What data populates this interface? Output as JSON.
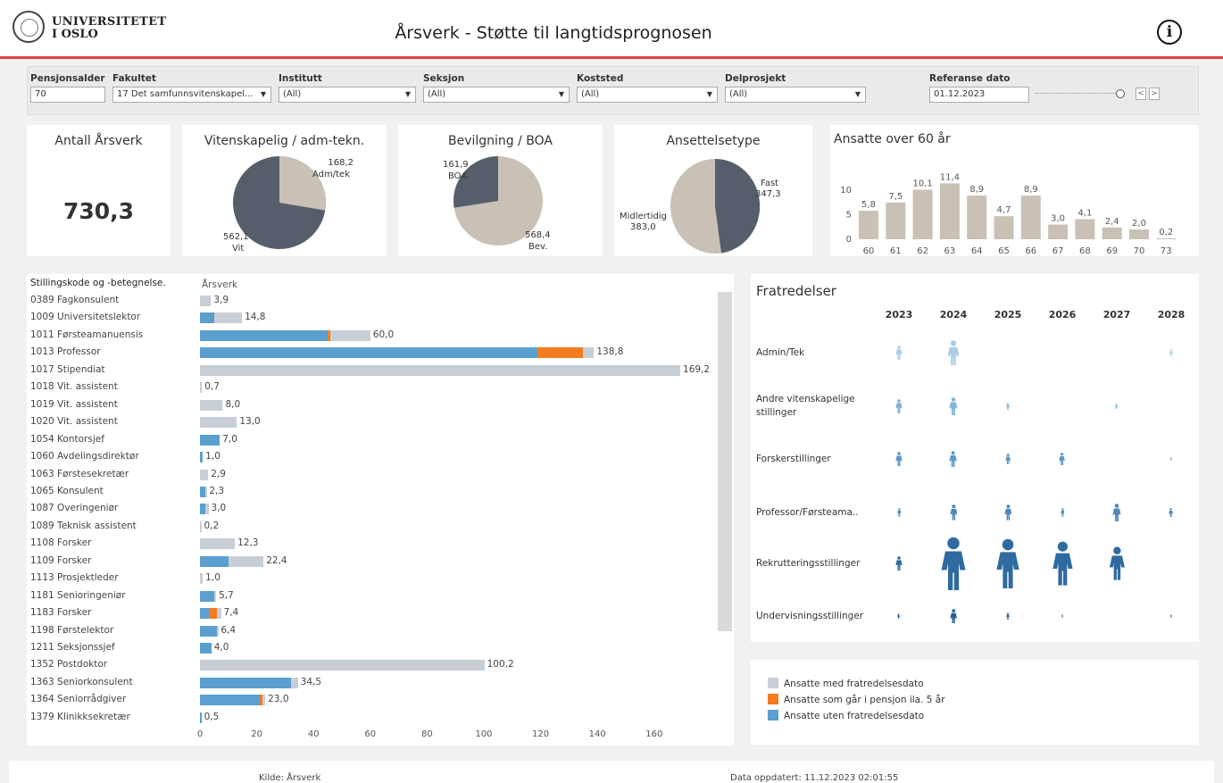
{
  "header": {
    "logo_line1": "UNIVERSITETET",
    "logo_line2": "I OSLO",
    "title": "Årsverk - Støtte til langtidsprognosen",
    "info_icon": "ⓘ"
  },
  "filters": {
    "pensjonsalder": {
      "label": "Pensjonsalder",
      "value": "70"
    },
    "fakultet": {
      "label": "Fakultet",
      "value": "17 Det samfunnsvitenskapel..."
    },
    "institutt": {
      "label": "Institutt",
      "value": "(All)"
    },
    "seksjon": {
      "label": "Seksjon",
      "value": "(All)"
    },
    "koststed": {
      "label": "Koststed",
      "value": "(All)"
    },
    "delprosjekt": {
      "label": "Delprosjekt",
      "value": "(All)"
    },
    "referanse": {
      "label": "Referanse dato",
      "value": "01.12.2023"
    }
  },
  "kpi": {
    "title": "Antall Årsverk",
    "value": "730,3"
  },
  "pies": {
    "vit": {
      "title": "Vitenskapelig / adm-tekn.",
      "a_val": "168,2",
      "a_lbl": "Adm/tek",
      "b_val": "562,1",
      "b_lbl": "Vit"
    },
    "bev": {
      "title": "Bevilgning / BOA",
      "a_val": "161,9",
      "a_lbl": "BOA",
      "b_val": "568,4",
      "b_lbl": "Bev."
    },
    "ans": {
      "title": "Ansettelsetype",
      "a_lbl": "Fast",
      "a_val": "347,3",
      "b_lbl": "Midlertidig",
      "b_val": "383,0"
    }
  },
  "over60": {
    "title": "Ansatte over 60 år"
  },
  "barlist": {
    "header_label": "Stillingskode og -betegnelse.",
    "header_value": "Årsverk"
  },
  "legend": {
    "grey": "Ansatte med fratredelsesdato",
    "orange": "Ansatte som går i pensjon ila. 5 år",
    "blue": "Ansatte uten fratredelsesdato"
  },
  "fratredelser": {
    "title": "Fratredelser",
    "years": [
      "2023",
      "2024",
      "2025",
      "2026",
      "2027",
      "2028"
    ],
    "categories": [
      {
        "line1": "Admin/Tek",
        "line2": "",
        "sizes": [
          2,
          3.5,
          0,
          0,
          0,
          1
        ],
        "color": "#a9cde6"
      },
      {
        "line1": "Andre vitenskapelige",
        "line2": "stillinger",
        "sizes": [
          2,
          2.5,
          1,
          0,
          0.8,
          0
        ],
        "color": "#7fb3d6"
      },
      {
        "line1": "Forskerstillinger",
        "line2": "",
        "sizes": [
          2,
          2.3,
          1.6,
          1.8,
          0,
          0.5
        ],
        "color": "#5b97c6"
      },
      {
        "line1": "Professor/Førsteama..",
        "line2": "",
        "sizes": [
          1.2,
          2.2,
          2.2,
          1.2,
          2.5,
          1.3
        ],
        "color": "#4d86b8"
      },
      {
        "line1": "Rekrutteringsstillinger",
        "line2": "",
        "sizes": [
          2,
          7.5,
          7,
          6.2,
          4.7,
          0
        ],
        "color": "#2f6aa0"
      },
      {
        "line1": "Undervisningsstillinger",
        "line2": "",
        "sizes": [
          0.8,
          2.1,
          1,
          0.5,
          0,
          0.5
        ],
        "color": "#2b5f90"
      }
    ]
  },
  "footer": {
    "source": "Kilde: Årsverk",
    "updated": "Data oppdatert: 11.12.2023 02:01:55"
  },
  "chart_data": [
    {
      "type": "bar",
      "title": "Ansatte over 60 år",
      "categories": [
        "60",
        "61",
        "62",
        "63",
        "64",
        "65",
        "66",
        "67",
        "68",
        "69",
        "70",
        "73"
      ],
      "values": [
        5.8,
        7.5,
        10.1,
        11.4,
        8.9,
        4.7,
        8.9,
        3.0,
        4.1,
        2.4,
        2.0,
        0.2
      ],
      "labels": [
        "5,8",
        "7,5",
        "10,1",
        "11,4",
        "8,9",
        "4,7",
        "8,9",
        "3,0",
        "4,1",
        "2,4",
        "2,0",
        "0,2"
      ],
      "yticks": [
        "10",
        "5",
        "0"
      ],
      "ylim": [
        0,
        13
      ],
      "color": "#c9c1b6"
    },
    {
      "type": "bar",
      "orientation": "horizontal-stacked",
      "title": "",
      "categories": [
        "0389 Fagkonsulent",
        "1009 Universitetslektor",
        "1011 Førsteamanuensis",
        "1013 Professor",
        "1017 Stipendiat",
        "1018 Vit. assistent",
        "1019 Vit. assistent",
        "1020 Vit. assistent",
        "1054 Kontorsjef",
        "1060 Avdelingsdirektør",
        "1063 Førstesekretær",
        "1065 Konsulent",
        "1087 Overingeniør",
        "1089 Teknisk assistent",
        "1108 Forsker",
        "1109 Forsker",
        "1113 Prosjektleder",
        "1181 Senioringeniør",
        "1183 Forsker",
        "1198 Førstelektor",
        "1211 Seksjonssjef",
        "1352 Postdoktor",
        "1363 Seniorkonsulent",
        "1364 Seniorrådgiver",
        "1379 Klinikksekretær"
      ],
      "series": [
        {
          "name": "Ansatte uten fratredelsesdato",
          "color": "#5b9fcf",
          "values": [
            0,
            5,
            45,
            119,
            0,
            0,
            0,
            0,
            7,
            1,
            0,
            2,
            2,
            0,
            0,
            10,
            0,
            5,
            3,
            6,
            4,
            0,
            32,
            21,
            0.5
          ]
        },
        {
          "name": "Ansatte som går i pensjon ila. 5 år",
          "color": "#f47c20",
          "values": [
            0,
            0,
            1,
            16,
            0,
            0,
            0,
            0,
            0,
            0,
            0,
            0,
            0,
            0,
            0,
            0,
            0,
            0,
            3,
            0,
            0,
            0,
            0,
            1,
            0
          ]
        },
        {
          "name": "Ansatte med fratredelsesdato",
          "color": "#c8ced6",
          "values": [
            3.9,
            9.8,
            14,
            3.8,
            169.2,
            0.7,
            8,
            13,
            0,
            0,
            2.9,
            0.3,
            1,
            0.2,
            12.3,
            12.4,
            1,
            0.7,
            1.4,
            0.4,
            0,
            100.2,
            2.5,
            1,
            0
          ]
        }
      ],
      "totals": [
        "3,9",
        "14,8",
        "60,0",
        "138,8",
        "169,2",
        "0,7",
        "8,0",
        "13,0",
        "7,0",
        "1,0",
        "2,9",
        "2,3",
        "3,0",
        "0,2",
        "12,3",
        "22,4",
        "1,0",
        "5,7",
        "7,4",
        "6,4",
        "4,0",
        "100,2",
        "34,5",
        "23,0",
        "0,5"
      ],
      "xticks": [
        "0",
        "20",
        "40",
        "60",
        "80",
        "100",
        "120",
        "140",
        "160"
      ],
      "xlim": [
        0,
        170
      ]
    }
  ]
}
